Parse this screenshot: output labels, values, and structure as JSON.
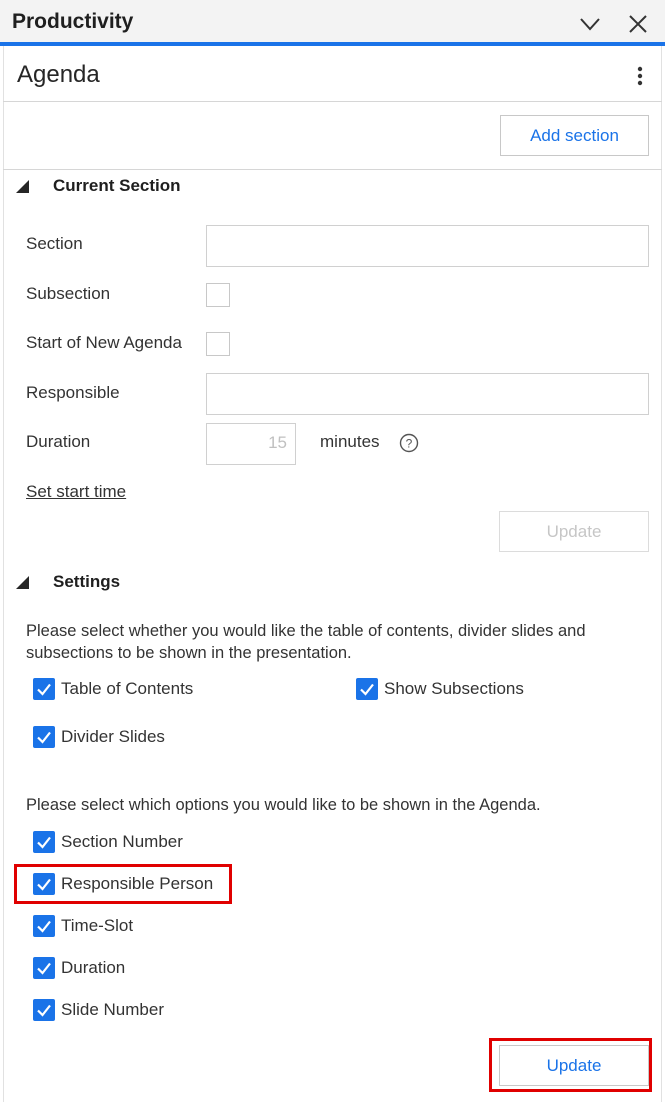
{
  "header": {
    "title": "Productivity"
  },
  "agenda": {
    "title": "Agenda"
  },
  "toolbar": {
    "add_section_label": "Add section"
  },
  "current_section": {
    "heading": "Current Section",
    "section_label": "Section",
    "section_value": "",
    "subsection_label": "Subsection",
    "new_agenda_label": "Start of New Agenda",
    "responsible_label": "Responsible",
    "responsible_value": "",
    "duration_label": "Duration",
    "duration_placeholder": "15",
    "duration_unit": "minutes",
    "set_start_time_label": "Set start time",
    "update_label": "Update"
  },
  "settings": {
    "heading": "Settings",
    "intro_1": "Please select whether you would like the table of contents, divider slides and subsections to be shown in the presentation.",
    "toc_label": "Table of Contents",
    "show_subsections_label": "Show Subsections",
    "divider_slides_label": "Divider Slides",
    "intro_2": "Please select which options you would like to be shown in the Agenda.",
    "options": [
      "Section Number",
      "Responsible Person",
      "Time-Slot",
      "Duration",
      "Slide Number"
    ],
    "update_label": "Update"
  },
  "colors": {
    "accent": "#1a73e8",
    "highlight": "#e00000"
  }
}
